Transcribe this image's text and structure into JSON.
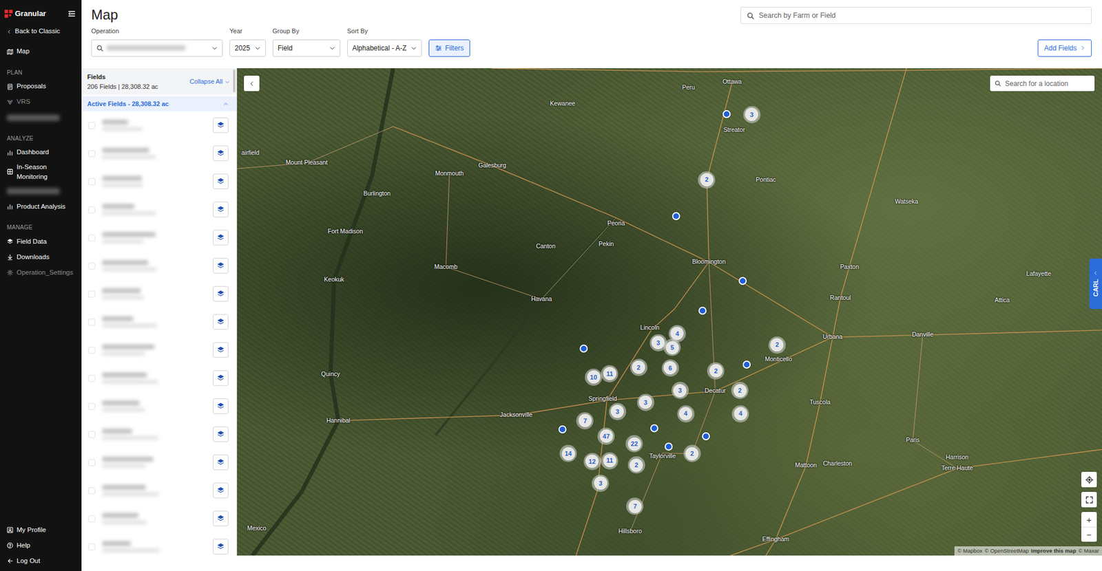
{
  "sidebar": {
    "logo": "Granular",
    "back": "Back to Classic",
    "top": [
      {
        "label": "Map"
      }
    ],
    "sections": [
      {
        "title": "PLAN",
        "items": [
          {
            "kind": "link",
            "label": "Proposals",
            "disabled": false
          },
          {
            "kind": "link",
            "label": "VRS",
            "disabled": true
          },
          {
            "kind": "blurred"
          }
        ]
      },
      {
        "title": "ANALYZE",
        "items": [
          {
            "kind": "link",
            "label": "Dashboard",
            "disabled": false
          },
          {
            "kind": "link",
            "label": "In-Season Monitoring",
            "disabled": false
          },
          {
            "kind": "blurred"
          },
          {
            "kind": "link",
            "label": "Product Analysis",
            "disabled": false
          }
        ]
      },
      {
        "title": "MANAGE",
        "items": [
          {
            "kind": "link",
            "label": "Field Data",
            "disabled": false
          },
          {
            "kind": "link",
            "label": "Downloads",
            "disabled": false
          },
          {
            "kind": "link",
            "label": "Operation_Settings",
            "disabled": true
          }
        ]
      }
    ],
    "bottom": [
      {
        "label": "My Profile"
      },
      {
        "label": "Help"
      },
      {
        "label": "Log Out"
      }
    ]
  },
  "header": {
    "title": "Map",
    "search": {
      "placeholder": "Search by Farm or Field"
    },
    "controls": [
      {
        "kind": "blurred",
        "label": "Operation"
      },
      {
        "kind": "select",
        "label": "Year",
        "value": "2025"
      },
      {
        "kind": "select",
        "label": "Group By",
        "value": "Field"
      },
      {
        "kind": "select",
        "label": "Sort By",
        "value": "Alphabetical - A-Z"
      }
    ],
    "filters_button": "Filters",
    "add_button": "Add Fields"
  },
  "fields": {
    "title": "Fields",
    "summary": "206 Fields | 28,308.32 ac",
    "collapse": "Collapse All",
    "group": {
      "label": "Active Fields - 28,308.32 ac",
      "expanded": true
    },
    "rows": [
      {
        "blurred": true
      },
      {
        "blurred": true
      },
      {
        "blurred": true
      },
      {
        "blurred": true
      },
      {
        "blurred": true
      },
      {
        "blurred": true
      },
      {
        "blurred": true
      },
      {
        "blurred": true
      },
      {
        "blurred": true
      },
      {
        "blurred": true
      },
      {
        "blurred": true
      },
      {
        "blurred": true
      },
      {
        "blurred": true
      },
      {
        "blurred": true
      },
      {
        "blurred": true
      },
      {
        "blurred": true
      }
    ]
  },
  "map": {
    "search": {
      "placeholder": "Search for a location"
    },
    "side_tab": "CARL",
    "labels": [
      {
        "text": "Ottawa"
      },
      {
        "text": "Peru"
      },
      {
        "text": "Streator"
      },
      {
        "text": "Kewanee"
      },
      {
        "text": "Pontiac"
      },
      {
        "text": "Watseka"
      },
      {
        "text": "Mount Pleasant"
      },
      {
        "text": "Galesburg"
      },
      {
        "text": "Monmouth"
      },
      {
        "text": "Burlington"
      },
      {
        "text": "Fort Madison"
      },
      {
        "text": "Peoria"
      },
      {
        "text": "Pekin"
      },
      {
        "text": "Canton"
      },
      {
        "text": "Macomb"
      },
      {
        "text": "Bloomington"
      },
      {
        "text": "Paxton"
      },
      {
        "text": "Keokuk"
      },
      {
        "text": "Lafayette"
      },
      {
        "text": "Havana"
      },
      {
        "text": "Rantoul"
      },
      {
        "text": "Attica"
      },
      {
        "text": "Lincoln"
      },
      {
        "text": "Urbana"
      },
      {
        "text": "Danville"
      },
      {
        "text": "Quincy"
      },
      {
        "text": "Monticello"
      },
      {
        "text": "Springfield"
      },
      {
        "text": "Decatur"
      },
      {
        "text": "Jacksonville"
      },
      {
        "text": "Tuscola"
      },
      {
        "text": "Hannibal"
      },
      {
        "text": "Taylorville"
      },
      {
        "text": "Paris"
      },
      {
        "text": "Mattoon"
      },
      {
        "text": "Charleston"
      },
      {
        "text": "Harrison"
      },
      {
        "text": "Terre Haute"
      },
      {
        "text": "Hillsboro"
      },
      {
        "text": "Effingham"
      },
      {
        "text": "Mexico"
      },
      {
        "text": "airfield"
      }
    ],
    "clusters": [
      {
        "count": "3"
      },
      {
        "count": "2"
      },
      {
        "count": "4"
      },
      {
        "count": "3"
      },
      {
        "count": "5"
      },
      {
        "count": "2"
      },
      {
        "count": "10"
      },
      {
        "count": "11"
      },
      {
        "count": "2"
      },
      {
        "count": "6"
      },
      {
        "count": "2"
      },
      {
        "count": "3"
      },
      {
        "count": "2"
      },
      {
        "count": "3"
      },
      {
        "count": "3"
      },
      {
        "count": "4"
      },
      {
        "count": "4"
      },
      {
        "count": "7"
      },
      {
        "count": "47"
      },
      {
        "count": "22"
      },
      {
        "count": "14"
      },
      {
        "count": "12"
      },
      {
        "count": "11"
      },
      {
        "count": "2"
      },
      {
        "count": "2"
      },
      {
        "count": "3"
      },
      {
        "count": "7"
      }
    ],
    "points": [
      {
        "kind": "field"
      },
      {
        "kind": "field"
      },
      {
        "kind": "field"
      },
      {
        "kind": "field"
      },
      {
        "kind": "field"
      },
      {
        "kind": "field"
      },
      {
        "kind": "field"
      },
      {
        "kind": "field"
      },
      {
        "kind": "field"
      },
      {
        "kind": "field"
      }
    ],
    "zoom_in": "+",
    "zoom_out": "−",
    "attribution": [
      "© Mapbox",
      "© OpenStreetMap",
      "Improve this map",
      "© Maxar"
    ]
  }
}
